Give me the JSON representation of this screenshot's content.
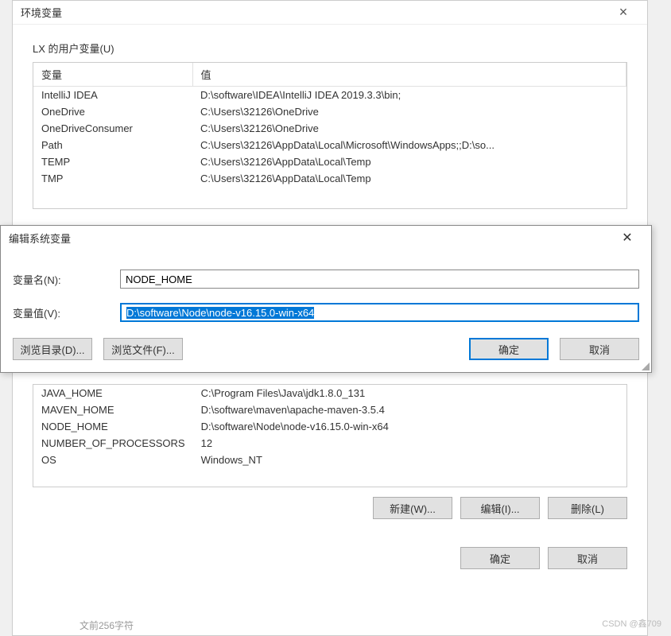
{
  "env_dialog": {
    "title": "环境变量",
    "user_section_label": "LX 的用户变量(U)",
    "columns": {
      "var": "变量",
      "val": "值"
    },
    "user_vars": [
      {
        "name": "IntelliJ IDEA",
        "value": "D:\\software\\IDEA\\IntelliJ IDEA 2019.3.3\\bin;"
      },
      {
        "name": "OneDrive",
        "value": "C:\\Users\\32126\\OneDrive"
      },
      {
        "name": "OneDriveConsumer",
        "value": "C:\\Users\\32126\\OneDrive"
      },
      {
        "name": "Path",
        "value": "C:\\Users\\32126\\AppData\\Local\\Microsoft\\WindowsApps;;D:\\so..."
      },
      {
        "name": "TEMP",
        "value": "C:\\Users\\32126\\AppData\\Local\\Temp"
      },
      {
        "name": "TMP",
        "value": "C:\\Users\\32126\\AppData\\Local\\Temp"
      }
    ],
    "sys_vars": [
      {
        "name": "JAVA_HOME",
        "value": "C:\\Program Files\\Java\\jdk1.8.0_131"
      },
      {
        "name": "MAVEN_HOME",
        "value": "D:\\software\\maven\\apache-maven-3.5.4"
      },
      {
        "name": "NODE_HOME",
        "value": "D:\\software\\Node\\node-v16.15.0-win-x64"
      },
      {
        "name": "NUMBER_OF_PROCESSORS",
        "value": "12"
      },
      {
        "name": "OS",
        "value": "Windows_NT"
      }
    ],
    "buttons": {
      "new": "新建(W)...",
      "edit": "编辑(I)...",
      "delete": "删除(L)",
      "ok": "确定",
      "cancel": "取消"
    }
  },
  "edit_dialog": {
    "title": "编辑系统变量",
    "name_label": "变量名(N):",
    "name_value": "NODE_HOME",
    "value_label": "变量值(V):",
    "value_value": "D:\\software\\Node\\node-v16.15.0-win-x64",
    "buttons": {
      "browse_dir": "浏览目录(D)...",
      "browse_file": "浏览文件(F)...",
      "ok": "确定",
      "cancel": "取消"
    }
  },
  "watermark": "CSDN @鑫709",
  "bottom_text": "文前256字符"
}
